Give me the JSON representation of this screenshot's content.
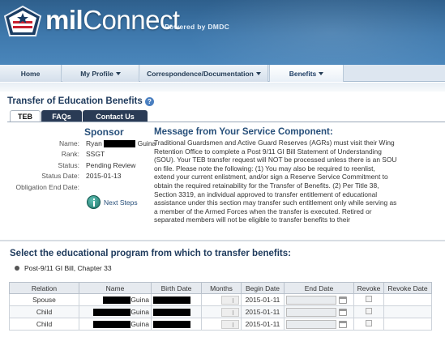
{
  "app": {
    "logo_text_bold": "mil",
    "logo_text_rest": "Connect",
    "powered_by": "Powered by DMDC"
  },
  "nav": {
    "items": [
      {
        "label": "Home",
        "has_caret": false
      },
      {
        "label": "My Profile",
        "has_caret": true
      },
      {
        "label": "Correspondence/Documentation",
        "has_caret": true
      },
      {
        "label": "Benefits",
        "has_caret": true,
        "active": true
      }
    ]
  },
  "page": {
    "title": "Transfer of Education Benefits",
    "help_glyph": "?"
  },
  "tabs": [
    {
      "label": "TEB",
      "active": true
    },
    {
      "label": "FAQs",
      "active": false
    },
    {
      "label": "Contact Us",
      "active": false
    }
  ],
  "sponsor": {
    "heading": "Sponsor",
    "fields": [
      {
        "label": "Name:",
        "value_prefix": "Ryan",
        "value_suffix": "Guina",
        "redacted": true
      },
      {
        "label": "Rank:",
        "value": "SSGT"
      },
      {
        "label": "Status:",
        "value": "Pending Review"
      },
      {
        "label": "Status Date:",
        "value": "2015-01-13"
      },
      {
        "label": "Obligation End Date:",
        "value": ""
      }
    ],
    "next_steps_label": "Next Steps"
  },
  "message": {
    "heading": "Message from Your Service Component:",
    "body": "Traditional Guardsmen and Active Guard Reserves (AGRs) must visit their Wing Retention Office to complete a Post 9/11 GI Bill Statement of Understanding (SOU). Your TEB transfer request will NOT be processed unless there is an SOU on file. Please note the following:  (1) You may also be required to reenlist, extend your current enlistment, and/or sign a Reserve Service Commitment to obtain the required retainability for the Transfer of Benefits. (2) Per Title 38, Section 3319, an individual approved to transfer entitlement of educational assistance under this section may transfer such entitlement only while serving as a member of the Armed Forces when the transfer is executed. Retired or separated members will not be eligible to transfer benefits to their"
  },
  "program": {
    "heading": "Select the educational program from which to transfer benefits:",
    "option": "Post-9/11 GI Bill, Chapter 33"
  },
  "table": {
    "headers": [
      "Relation",
      "Name",
      "Birth Date",
      "Months",
      "Begin Date",
      "End Date",
      "Revoke",
      "Revoke Date"
    ],
    "rows": [
      {
        "relation": "Spouse",
        "name_suffix": "Guina",
        "begin_date": "2015-01-11"
      },
      {
        "relation": "Child",
        "name_suffix": "Guina",
        "begin_date": "2015-01-11"
      },
      {
        "relation": "Child",
        "name_suffix": "Guina",
        "begin_date": "2015-01-11"
      }
    ]
  },
  "colors": {
    "header_blue": "#3f79ad",
    "heading_blue": "#274f7a",
    "tab_dark": "#2a3b55",
    "next_steps_teal": "#1d7468"
  }
}
